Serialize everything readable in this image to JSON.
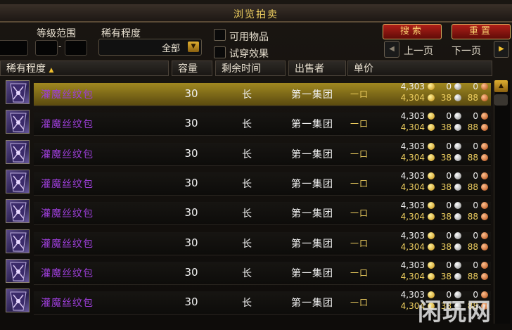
{
  "window": {
    "title": "浏览拍卖"
  },
  "filters": {
    "level_range_label": "等级范围",
    "level_dash": "-",
    "rarity_label": "稀有程度",
    "rarity_value": "全部",
    "usable_label": "可用物品",
    "tryon_label": "试穿效果"
  },
  "buttons": {
    "search": "搜索",
    "reset": "重置",
    "prev": "上一页",
    "next": "下一页"
  },
  "columns": {
    "rarity": "稀有程度",
    "capacity": "容量",
    "time_left": "剩余时间",
    "seller": "出售者",
    "unit_price": "单价"
  },
  "rows": [
    {
      "name": "灌魔丝纹包",
      "capacity": "30",
      "time": "长",
      "seller": "第一集团",
      "buyout": "一口",
      "bid": {
        "g": "4,303",
        "s": "0",
        "c": "0"
      },
      "buy": {
        "g": "4,304",
        "s": "38",
        "c": "88"
      }
    },
    {
      "name": "灌魔丝纹包",
      "capacity": "30",
      "time": "长",
      "seller": "第一集团",
      "buyout": "一口",
      "bid": {
        "g": "4,303",
        "s": "0",
        "c": "0"
      },
      "buy": {
        "g": "4,304",
        "s": "38",
        "c": "88"
      }
    },
    {
      "name": "灌魔丝纹包",
      "capacity": "30",
      "time": "长",
      "seller": "第一集团",
      "buyout": "一口",
      "bid": {
        "g": "4,303",
        "s": "0",
        "c": "0"
      },
      "buy": {
        "g": "4,304",
        "s": "38",
        "c": "88"
      }
    },
    {
      "name": "灌魔丝纹包",
      "capacity": "30",
      "time": "长",
      "seller": "第一集团",
      "buyout": "一口",
      "bid": {
        "g": "4,303",
        "s": "0",
        "c": "0"
      },
      "buy": {
        "g": "4,304",
        "s": "38",
        "c": "88"
      }
    },
    {
      "name": "灌魔丝纹包",
      "capacity": "30",
      "time": "长",
      "seller": "第一集团",
      "buyout": "一口",
      "bid": {
        "g": "4,303",
        "s": "0",
        "c": "0"
      },
      "buy": {
        "g": "4,304",
        "s": "38",
        "c": "88"
      }
    },
    {
      "name": "灌魔丝纹包",
      "capacity": "30",
      "time": "长",
      "seller": "第一集团",
      "buyout": "一口",
      "bid": {
        "g": "4,303",
        "s": "0",
        "c": "0"
      },
      "buy": {
        "g": "4,304",
        "s": "38",
        "c": "88"
      }
    },
    {
      "name": "灌魔丝纹包",
      "capacity": "30",
      "time": "长",
      "seller": "第一集团",
      "buyout": "一口",
      "bid": {
        "g": "4,303",
        "s": "0",
        "c": "0"
      },
      "buy": {
        "g": "4,304",
        "s": "38",
        "c": "88"
      }
    },
    {
      "name": "灌魔丝纹包",
      "capacity": "30",
      "time": "长",
      "seller": "第一集团",
      "buyout": "一口",
      "bid": {
        "g": "4,303",
        "s": "0",
        "c": "0"
      },
      "buy": {
        "g": "4,304",
        "s": "38",
        "c": "88"
      }
    }
  ],
  "watermark": "闲玩网",
  "colors": {
    "item_epic": "#9c3ed8",
    "gold_text": "#f0d060",
    "button_red": "#b02018",
    "selected_row": "#a08820"
  }
}
